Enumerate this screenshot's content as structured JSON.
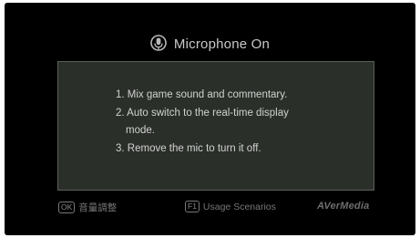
{
  "header": {
    "icon": "microphone-icon",
    "title": "Microphone On"
  },
  "info": {
    "items": [
      "1. Mix game sound and commentary.",
      "2. Auto switch to the real-time display",
      "mode.",
      "3. Remove the mic to turn it off."
    ]
  },
  "footer": {
    "ok_key": "OK",
    "ok_label": "音量調整",
    "usage_key": "F1",
    "usage_label": "Usage Scenarios",
    "brand": "AVerMedia"
  },
  "colors": {
    "background": "#000000",
    "panel": "#2a2f29",
    "panel_border": "#5a5f58",
    "text": "#d2d2d2",
    "footer_text": "#777777"
  }
}
